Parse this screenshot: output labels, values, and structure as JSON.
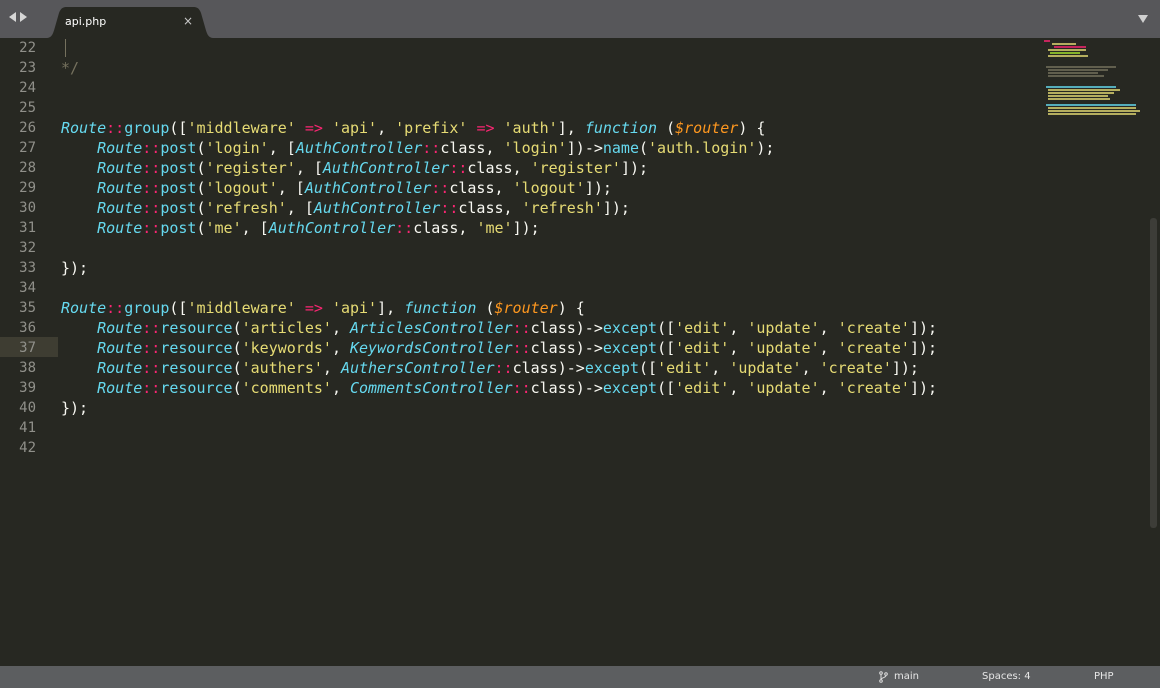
{
  "tab": {
    "title": "api.php",
    "close_glyph": "×"
  },
  "icons": {
    "nav_back": "left-arrow-icon",
    "nav_forward": "right-arrow-icon",
    "tab_close": "close-icon",
    "tab_menu": "chevron-down-icon",
    "branch": "git-branch-icon"
  },
  "editor": {
    "current_line": 37,
    "lines": [
      {
        "n": "22",
        "tokens": []
      },
      {
        "n": "23",
        "tokens": [
          {
            "t": "*/",
            "c": "cmt"
          }
        ]
      },
      {
        "n": "24",
        "tokens": []
      },
      {
        "n": "25",
        "tokens": []
      },
      {
        "n": "26",
        "tokens": [
          {
            "t": "Route",
            "c": "cls"
          },
          {
            "t": "::",
            "c": "kw"
          },
          {
            "t": "group",
            "c": "fn"
          },
          {
            "t": "([",
            "c": "plain"
          },
          {
            "t": "'middleware'",
            "c": "str"
          },
          {
            "t": " ",
            "c": "plain"
          },
          {
            "t": "=>",
            "c": "kw"
          },
          {
            "t": " ",
            "c": "plain"
          },
          {
            "t": "'api'",
            "c": "str"
          },
          {
            "t": ", ",
            "c": "plain"
          },
          {
            "t": "'prefix'",
            "c": "str"
          },
          {
            "t": " ",
            "c": "plain"
          },
          {
            "t": "=>",
            "c": "kw"
          },
          {
            "t": " ",
            "c": "plain"
          },
          {
            "t": "'auth'",
            "c": "str"
          },
          {
            "t": "], ",
            "c": "plain"
          },
          {
            "t": "function",
            "c": "store"
          },
          {
            "t": " (",
            "c": "plain"
          },
          {
            "t": "$router",
            "c": "var"
          },
          {
            "t": ") {",
            "c": "plain"
          }
        ]
      },
      {
        "n": "27",
        "tokens": [
          {
            "t": "    ",
            "c": "plain"
          },
          {
            "t": "Route",
            "c": "cls"
          },
          {
            "t": "::",
            "c": "kw"
          },
          {
            "t": "post",
            "c": "fn"
          },
          {
            "t": "(",
            "c": "plain"
          },
          {
            "t": "'login'",
            "c": "str"
          },
          {
            "t": ", [",
            "c": "plain"
          },
          {
            "t": "AuthController",
            "c": "cls"
          },
          {
            "t": "::",
            "c": "kw"
          },
          {
            "t": "class",
            "c": "plain"
          },
          {
            "t": ", ",
            "c": "plain"
          },
          {
            "t": "'login'",
            "c": "str"
          },
          {
            "t": "])",
            "c": "plain"
          },
          {
            "t": "->",
            "c": "plain"
          },
          {
            "t": "name",
            "c": "fn"
          },
          {
            "t": "(",
            "c": "plain"
          },
          {
            "t": "'auth.login'",
            "c": "str"
          },
          {
            "t": ");",
            "c": "plain"
          }
        ]
      },
      {
        "n": "28",
        "tokens": [
          {
            "t": "    ",
            "c": "plain"
          },
          {
            "t": "Route",
            "c": "cls"
          },
          {
            "t": "::",
            "c": "kw"
          },
          {
            "t": "post",
            "c": "fn"
          },
          {
            "t": "(",
            "c": "plain"
          },
          {
            "t": "'register'",
            "c": "str"
          },
          {
            "t": ", [",
            "c": "plain"
          },
          {
            "t": "AuthController",
            "c": "cls"
          },
          {
            "t": "::",
            "c": "kw"
          },
          {
            "t": "class",
            "c": "plain"
          },
          {
            "t": ", ",
            "c": "plain"
          },
          {
            "t": "'register'",
            "c": "str"
          },
          {
            "t": "]);",
            "c": "plain"
          }
        ]
      },
      {
        "n": "29",
        "tokens": [
          {
            "t": "    ",
            "c": "plain"
          },
          {
            "t": "Route",
            "c": "cls"
          },
          {
            "t": "::",
            "c": "kw"
          },
          {
            "t": "post",
            "c": "fn"
          },
          {
            "t": "(",
            "c": "plain"
          },
          {
            "t": "'logout'",
            "c": "str"
          },
          {
            "t": ", [",
            "c": "plain"
          },
          {
            "t": "AuthController",
            "c": "cls"
          },
          {
            "t": "::",
            "c": "kw"
          },
          {
            "t": "class",
            "c": "plain"
          },
          {
            "t": ", ",
            "c": "plain"
          },
          {
            "t": "'logout'",
            "c": "str"
          },
          {
            "t": "]);",
            "c": "plain"
          }
        ]
      },
      {
        "n": "30",
        "tokens": [
          {
            "t": "    ",
            "c": "plain"
          },
          {
            "t": "Route",
            "c": "cls"
          },
          {
            "t": "::",
            "c": "kw"
          },
          {
            "t": "post",
            "c": "fn"
          },
          {
            "t": "(",
            "c": "plain"
          },
          {
            "t": "'refresh'",
            "c": "str"
          },
          {
            "t": ", [",
            "c": "plain"
          },
          {
            "t": "AuthController",
            "c": "cls"
          },
          {
            "t": "::",
            "c": "kw"
          },
          {
            "t": "class",
            "c": "plain"
          },
          {
            "t": ", ",
            "c": "plain"
          },
          {
            "t": "'refresh'",
            "c": "str"
          },
          {
            "t": "]);",
            "c": "plain"
          }
        ]
      },
      {
        "n": "31",
        "tokens": [
          {
            "t": "    ",
            "c": "plain"
          },
          {
            "t": "Route",
            "c": "cls"
          },
          {
            "t": "::",
            "c": "kw"
          },
          {
            "t": "post",
            "c": "fn"
          },
          {
            "t": "(",
            "c": "plain"
          },
          {
            "t": "'me'",
            "c": "str"
          },
          {
            "t": ", [",
            "c": "plain"
          },
          {
            "t": "AuthController",
            "c": "cls"
          },
          {
            "t": "::",
            "c": "kw"
          },
          {
            "t": "class",
            "c": "plain"
          },
          {
            "t": ", ",
            "c": "plain"
          },
          {
            "t": "'me'",
            "c": "str"
          },
          {
            "t": "]);",
            "c": "plain"
          }
        ]
      },
      {
        "n": "32",
        "tokens": []
      },
      {
        "n": "33",
        "tokens": [
          {
            "t": "});",
            "c": "plain"
          }
        ]
      },
      {
        "n": "34",
        "tokens": []
      },
      {
        "n": "35",
        "tokens": [
          {
            "t": "Route",
            "c": "cls"
          },
          {
            "t": "::",
            "c": "kw"
          },
          {
            "t": "group",
            "c": "fn"
          },
          {
            "t": "([",
            "c": "plain"
          },
          {
            "t": "'middleware'",
            "c": "str"
          },
          {
            "t": " ",
            "c": "plain"
          },
          {
            "t": "=>",
            "c": "kw"
          },
          {
            "t": " ",
            "c": "plain"
          },
          {
            "t": "'api'",
            "c": "str"
          },
          {
            "t": "], ",
            "c": "plain"
          },
          {
            "t": "function",
            "c": "store"
          },
          {
            "t": " (",
            "c": "plain"
          },
          {
            "t": "$router",
            "c": "var"
          },
          {
            "t": ") {",
            "c": "plain"
          }
        ]
      },
      {
        "n": "36",
        "tokens": [
          {
            "t": "    ",
            "c": "plain"
          },
          {
            "t": "Route",
            "c": "cls"
          },
          {
            "t": "::",
            "c": "kw"
          },
          {
            "t": "resource",
            "c": "fn"
          },
          {
            "t": "(",
            "c": "plain"
          },
          {
            "t": "'articles'",
            "c": "str"
          },
          {
            "t": ", ",
            "c": "plain"
          },
          {
            "t": "ArticlesController",
            "c": "cls"
          },
          {
            "t": "::",
            "c": "kw"
          },
          {
            "t": "class",
            "c": "plain"
          },
          {
            "t": ")->",
            "c": "plain"
          },
          {
            "t": "except",
            "c": "fn"
          },
          {
            "t": "([",
            "c": "plain"
          },
          {
            "t": "'edit'",
            "c": "str"
          },
          {
            "t": ", ",
            "c": "plain"
          },
          {
            "t": "'update'",
            "c": "str"
          },
          {
            "t": ", ",
            "c": "plain"
          },
          {
            "t": "'create'",
            "c": "str"
          },
          {
            "t": "]);",
            "c": "plain"
          }
        ]
      },
      {
        "n": "37",
        "tokens": [
          {
            "t": "    ",
            "c": "plain"
          },
          {
            "t": "Route",
            "c": "cls"
          },
          {
            "t": "::",
            "c": "kw"
          },
          {
            "t": "resource",
            "c": "fn"
          },
          {
            "t": "(",
            "c": "plain"
          },
          {
            "t": "'keywords'",
            "c": "str"
          },
          {
            "t": ", ",
            "c": "plain"
          },
          {
            "t": "KeywordsController",
            "c": "cls"
          },
          {
            "t": "::",
            "c": "kw"
          },
          {
            "t": "class",
            "c": "plain"
          },
          {
            "t": ")->",
            "c": "plain"
          },
          {
            "t": "except",
            "c": "fn"
          },
          {
            "t": "([",
            "c": "plain"
          },
          {
            "t": "'edit'",
            "c": "str"
          },
          {
            "t": ", ",
            "c": "plain"
          },
          {
            "t": "'update'",
            "c": "str"
          },
          {
            "t": ", ",
            "c": "plain"
          },
          {
            "t": "'create'",
            "c": "str"
          },
          {
            "t": "]);",
            "c": "plain"
          }
        ]
      },
      {
        "n": "38",
        "tokens": [
          {
            "t": "    ",
            "c": "plain"
          },
          {
            "t": "Route",
            "c": "cls"
          },
          {
            "t": "::",
            "c": "kw"
          },
          {
            "t": "resource",
            "c": "fn"
          },
          {
            "t": "(",
            "c": "plain"
          },
          {
            "t": "'authers'",
            "c": "str"
          },
          {
            "t": ", ",
            "c": "plain"
          },
          {
            "t": "AuthersController",
            "c": "cls"
          },
          {
            "t": "::",
            "c": "kw"
          },
          {
            "t": "class",
            "c": "plain"
          },
          {
            "t": ")->",
            "c": "plain"
          },
          {
            "t": "except",
            "c": "fn"
          },
          {
            "t": "([",
            "c": "plain"
          },
          {
            "t": "'edit'",
            "c": "str"
          },
          {
            "t": ", ",
            "c": "plain"
          },
          {
            "t": "'update'",
            "c": "str"
          },
          {
            "t": ", ",
            "c": "plain"
          },
          {
            "t": "'create'",
            "c": "str"
          },
          {
            "t": "]);",
            "c": "plain"
          }
        ]
      },
      {
        "n": "39",
        "tokens": [
          {
            "t": "    ",
            "c": "plain"
          },
          {
            "t": "Route",
            "c": "cls"
          },
          {
            "t": "::",
            "c": "kw"
          },
          {
            "t": "resource",
            "c": "fn"
          },
          {
            "t": "(",
            "c": "plain"
          },
          {
            "t": "'comments'",
            "c": "str"
          },
          {
            "t": ", ",
            "c": "plain"
          },
          {
            "t": "CommentsController",
            "c": "cls"
          },
          {
            "t": "::",
            "c": "kw"
          },
          {
            "t": "class",
            "c": "plain"
          },
          {
            "t": ")->",
            "c": "plain"
          },
          {
            "t": "except",
            "c": "fn"
          },
          {
            "t": "([",
            "c": "plain"
          },
          {
            "t": "'edit'",
            "c": "str"
          },
          {
            "t": ", ",
            "c": "plain"
          },
          {
            "t": "'update'",
            "c": "str"
          },
          {
            "t": ", ",
            "c": "plain"
          },
          {
            "t": "'create'",
            "c": "str"
          },
          {
            "t": "]);",
            "c": "plain"
          }
        ]
      },
      {
        "n": "40",
        "tokens": [
          {
            "t": "});",
            "c": "plain"
          }
        ]
      },
      {
        "n": "41",
        "tokens": []
      },
      {
        "n": "42",
        "tokens": []
      }
    ]
  },
  "status": {
    "branch": "main",
    "indentation": "Spaces: 4",
    "syntax": "PHP"
  },
  "colors": {
    "background": "#272822",
    "tabbar": "#57575a",
    "statusbar": "#5c5e60",
    "class": "#66d9ef",
    "string": "#e6db74",
    "keyword": "#f92672",
    "variable": "#fd971f",
    "comment": "#75715e"
  }
}
